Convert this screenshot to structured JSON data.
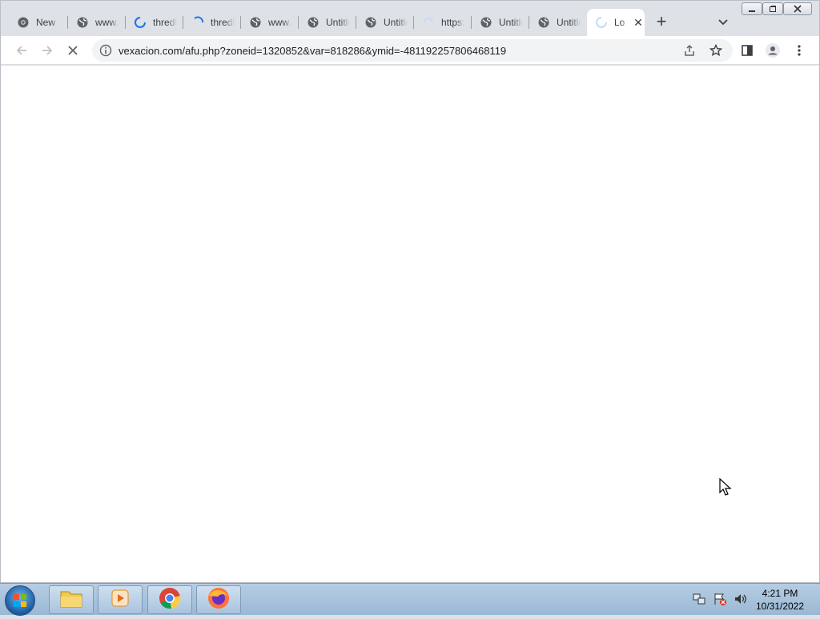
{
  "tabs": [
    {
      "title": "New Tab",
      "icon": "chrome-icon"
    },
    {
      "title": "www.a",
      "icon": "globe-icon"
    },
    {
      "title": "thredl",
      "icon": "loading-icon"
    },
    {
      "title": "thredl",
      "icon": "loading-icon"
    },
    {
      "title": "www.a",
      "icon": "globe-icon"
    },
    {
      "title": "Untitle",
      "icon": "globe-icon"
    },
    {
      "title": "Untitle",
      "icon": "globe-icon"
    },
    {
      "title": "https:",
      "icon": "blank-icon"
    },
    {
      "title": "Untitle",
      "icon": "globe-icon"
    },
    {
      "title": "Untitle",
      "icon": "globe-icon"
    },
    {
      "title": "Lo",
      "icon": "loading-icon",
      "active": true
    }
  ],
  "omnibox": {
    "url": "vexacion.com/afu.php?zoneid=1320852&var=818286&ymid=-481192257806468119"
  },
  "clock": {
    "time": "4:21 PM",
    "date": "10/31/2022"
  },
  "colors": {
    "accent": "#1a73e8",
    "tabstrip": "#dee1e6",
    "taskbar": "#9bb8d4"
  }
}
